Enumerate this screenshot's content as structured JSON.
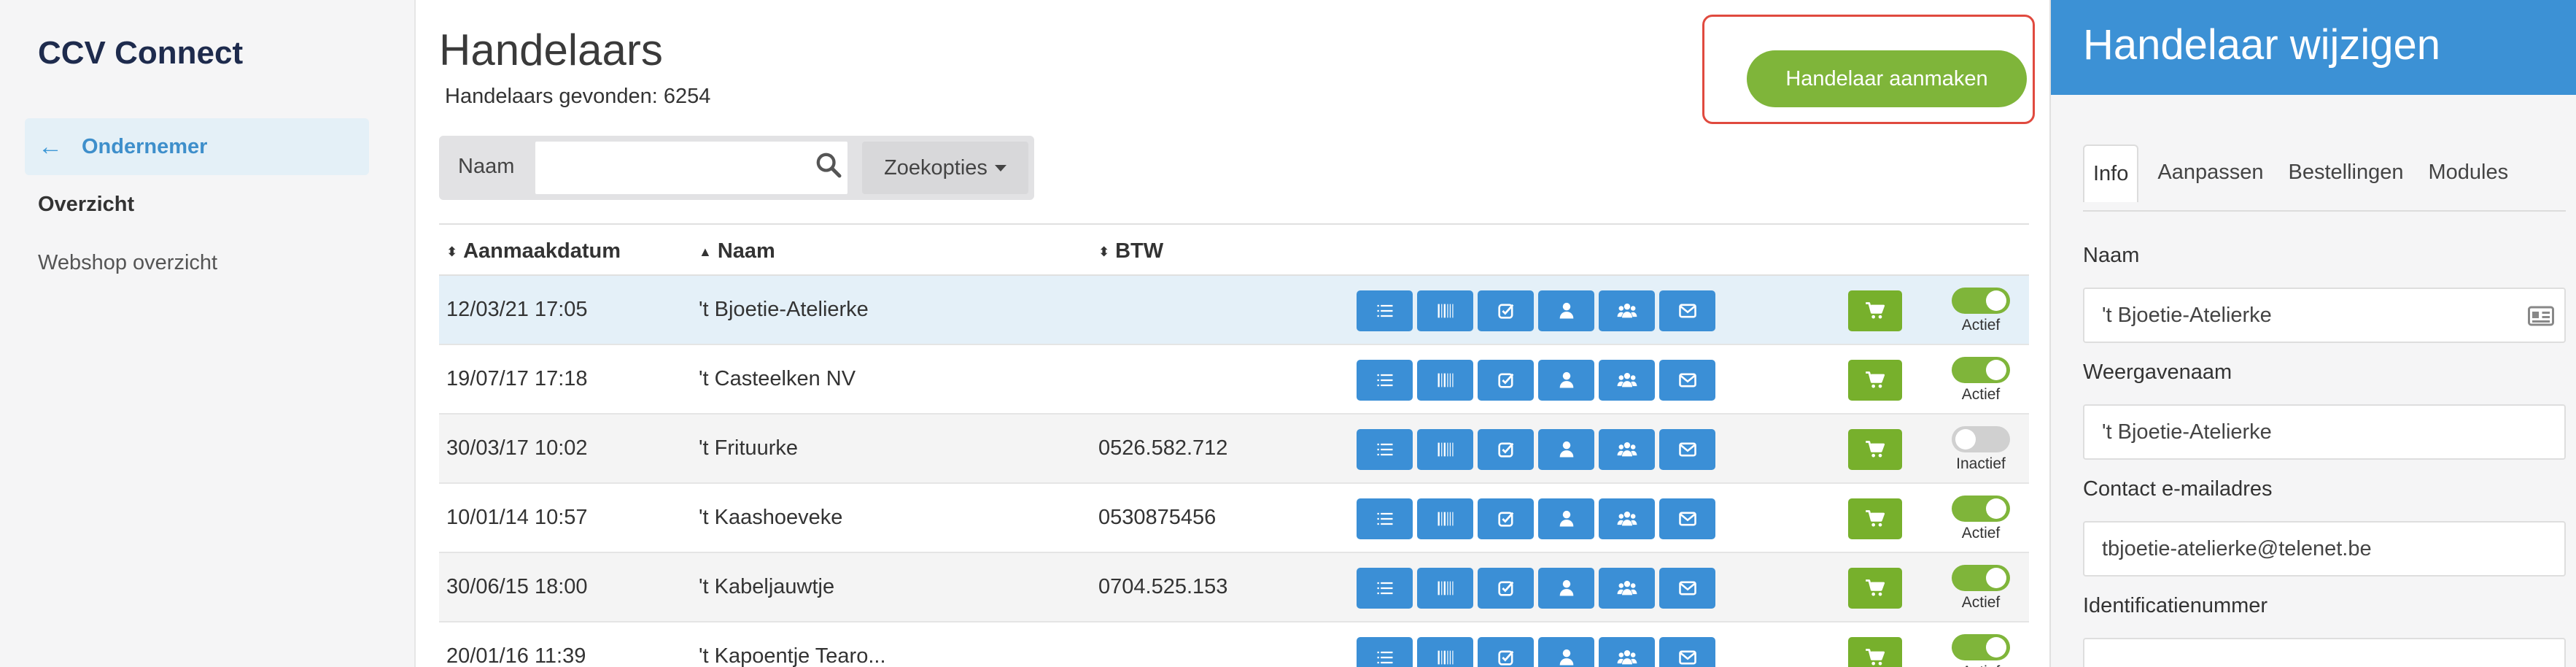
{
  "sidebar": {
    "brand": "CCV Connect",
    "active_item": {
      "icon": "arrow-left-icon",
      "label": "Ondernemer"
    },
    "items": [
      {
        "label": "Overzicht"
      },
      {
        "label": "Webshop overzicht"
      }
    ]
  },
  "main": {
    "title": "Handelaars",
    "found_label": "Handelaars gevonden: 6254",
    "create_button": "Handelaar aanmaken",
    "search": {
      "label": "Naam",
      "value": "",
      "placeholder": "",
      "options_label": "Zoekopties"
    },
    "table": {
      "columns": [
        "Aanmaakdatum",
        "Naam",
        "BTW"
      ],
      "rows": [
        {
          "date": "12/03/21 17:05",
          "name": "'t Bjoetie-Atelierke",
          "btw": "",
          "status": "Actief",
          "active": true
        },
        {
          "date": "19/07/17 17:18",
          "name": "'t Casteelken NV",
          "btw": "",
          "status": "Actief",
          "active": true
        },
        {
          "date": "30/03/17 10:02",
          "name": "'t Frituurke",
          "btw": "0526.582.712",
          "status": "Inactief",
          "active": false
        },
        {
          "date": "10/01/14 10:57",
          "name": "'t Kaashoeveke",
          "btw": "0530875456",
          "status": "Actief",
          "active": true
        },
        {
          "date": "30/06/15 18:00",
          "name": "'t Kabeljauwtje",
          "btw": "0704.525.153",
          "status": "Actief",
          "active": true
        },
        {
          "date": "20/01/16 11:39",
          "name": "'t Kapoentje Tearo...",
          "btw": "",
          "status": "Actief",
          "active": true
        }
      ],
      "row_actions": [
        "list-icon",
        "barcode-icon",
        "check-square-icon",
        "user-icon",
        "users-icon",
        "envelope-icon"
      ]
    }
  },
  "panel": {
    "title": "Handelaar wijzigen",
    "tabs": [
      "Info",
      "Aanpassen",
      "Bestellingen",
      "Modules"
    ],
    "active_tab": "Info",
    "fields": [
      {
        "label": "Naam",
        "value": "'t Bjoetie-Atelierke"
      },
      {
        "label": "Weergavenaam",
        "value": "'t Bjoetie-Atelierke"
      },
      {
        "label": "Contact e-mailadres",
        "value": "tbjoetie-atelierke@telenet.be"
      },
      {
        "label": "Identificatienummer",
        "value": ""
      }
    ]
  },
  "colors": {
    "brand_navy": "#1e2b4d",
    "accent_blue": "#3c91d5",
    "green": "#7fb53a",
    "highlight_red": "#e04a3f"
  }
}
